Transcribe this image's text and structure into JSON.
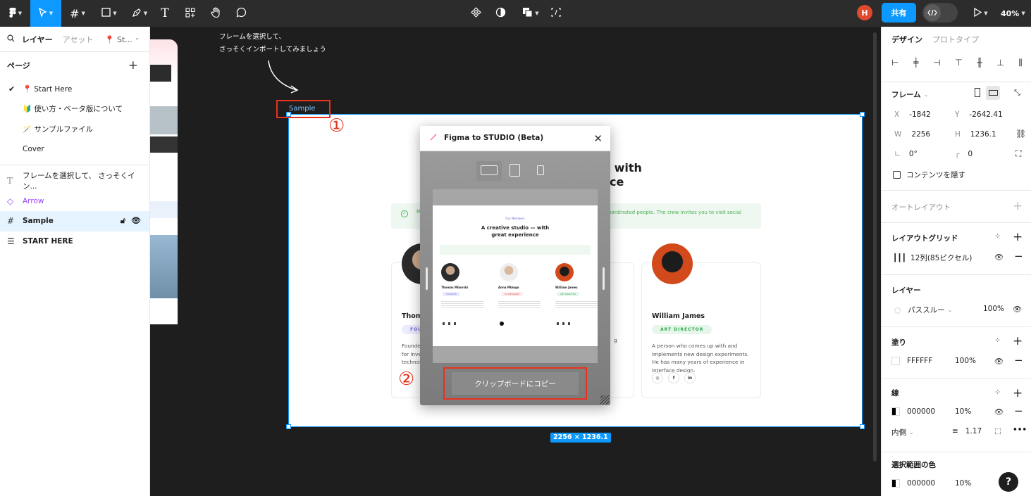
{
  "toolbar": {
    "zoom": "40%",
    "share_label": "共有",
    "user_initial": "H"
  },
  "left_panel": {
    "tabs": [
      "レイヤー",
      "アセット"
    ],
    "page_picker": "📍 St...",
    "pages_title": "ページ",
    "pages": [
      {
        "label": "📍 Start Here",
        "current": true
      },
      {
        "label": "🔰 使い方・ベータ版について",
        "current": false
      },
      {
        "label": "🪄 サンプルファイル",
        "current": false
      },
      {
        "label": "Cover",
        "current": false
      }
    ],
    "layers": [
      {
        "label": "フレームを選択して、 さっそくイン...",
        "kind": "text"
      },
      {
        "label": "Arrow",
        "kind": "component"
      },
      {
        "label": "Sample",
        "kind": "frame"
      },
      {
        "label": "START HERE",
        "kind": "group"
      }
    ]
  },
  "canvas": {
    "annotation_line1": "フレームを選択して、",
    "annotation_line2": "さっそくインポートしてみましょう",
    "frame_label": "Sample",
    "step1": "①",
    "step2": "②",
    "dimensions": "2256 × 1236.1",
    "frame": {
      "heading_line1": "— with",
      "heading_line2": "ce",
      "banner_text_1": "M",
      "banner_text_2": "well-coordinated people. The crew invites you to visit social",
      "card1_name": "Thoma",
      "card1_role": "FOU",
      "card1_desc_1": "Founder",
      "card1_desc_2": "for invest",
      "card1_desc_3": "technolo",
      "card3_name": "William James",
      "card3_role": "ART DIRECTOR",
      "card3_desc": "A person who comes up with and implements new design experiments. He has many years of experience in interface design.",
      "card3_extra": "g"
    },
    "plugin": {
      "title": "Figma to STUDIO (Beta)",
      "copy_label": "クリップボードにコピー",
      "preview": {
        "eyebrow": "Our Members",
        "title_line1": "A creative studio — with",
        "title_line2": "great experience",
        "members": [
          {
            "name": "Thomas Mikorski",
            "role": "FOUNDER"
          },
          {
            "name": "Anna Mbingo",
            "role": "UX DESIGNER"
          },
          {
            "name": "William James",
            "role": "ART DIRECTOR"
          }
        ]
      }
    }
  },
  "right_panel": {
    "tabs": [
      "デザイン",
      "プロトタイプ"
    ],
    "frame_title": "フレーム",
    "x_label": "X",
    "x": "-1842",
    "y_label": "Y",
    "y": "-2642.41",
    "w_label": "W",
    "w": "2256",
    "h_label": "H",
    "h": "1236.1",
    "rotation": "0°",
    "radius": "0",
    "clip_label": "コンテンツを隠す",
    "auto_layout": "オートレイアウト",
    "layout_grid_title": "レイアウトグリッド",
    "layout_grid_value": "12列(85ピクセル)",
    "layer_title": "レイヤー",
    "blend_mode": "パススルー",
    "layer_opacity": "100%",
    "fill_title": "塗り",
    "fill_hex": "FFFFFF",
    "fill_opacity": "100%",
    "stroke_title": "線",
    "stroke_hex": "000000",
    "stroke_opacity": "10%",
    "stroke_position": "内側",
    "stroke_width": "1.17",
    "selection_colors_title": "選択範囲の色",
    "selection_hex": "000000",
    "selection_opacity": "10%",
    "help": "?"
  }
}
